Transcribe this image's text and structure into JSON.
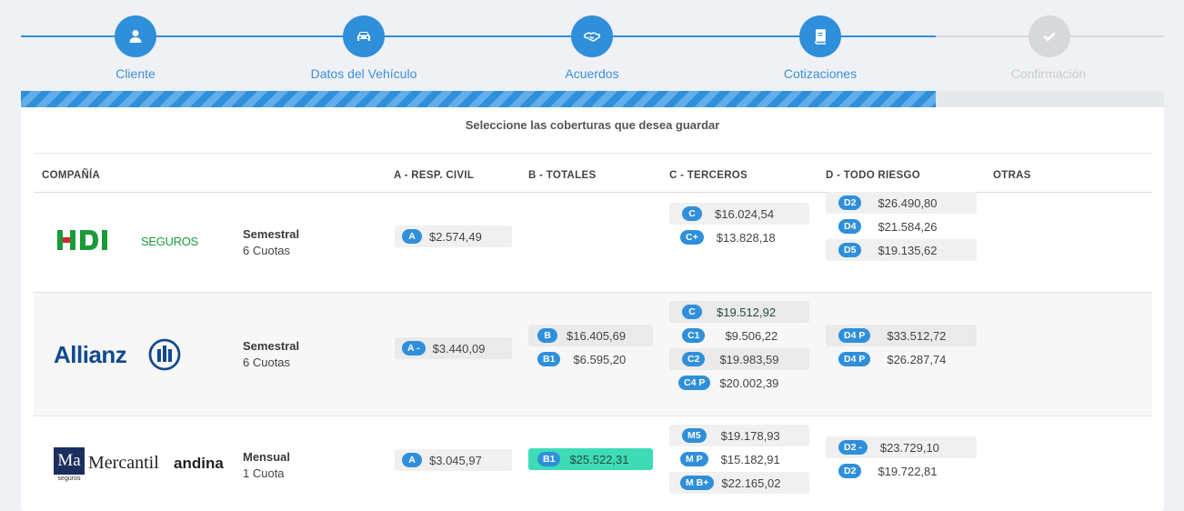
{
  "stepper": {
    "steps": [
      {
        "label": "Cliente",
        "icon": "user-icon",
        "state": "done"
      },
      {
        "label": "Datos del Vehículo",
        "icon": "car-icon",
        "state": "done"
      },
      {
        "label": "Acuerdos",
        "icon": "handshake-icon",
        "state": "done"
      },
      {
        "label": "Cotizaciones",
        "icon": "book-icon",
        "state": "current"
      },
      {
        "label": "Confirmación",
        "icon": "check-icon",
        "state": "pending"
      }
    ],
    "progress_fraction": 0.8,
    "accent": "#2f8fdb"
  },
  "card": {
    "title": "Seleccione las coberturas que desea guardar",
    "headers": {
      "company": "COMPAÑÍA",
      "a": "A - RESP. CIVIL",
      "b": "B - TOTALES",
      "c": "C - TERCEROS",
      "d": "D - TODO RIESGO",
      "other": "OTRAS"
    },
    "rows": [
      {
        "company": "HDI SEGUROS",
        "logo_main": "HDI",
        "logo_sub": "SEGUROS",
        "plan": "Semestral",
        "cuotas": "6 Cuotas",
        "a": [
          {
            "tag": "A",
            "amount": "$2.574,49"
          }
        ],
        "b": [],
        "c": [
          {
            "tag": "C",
            "amount": "$16.024,54"
          },
          {
            "tag": "C+",
            "amount": "$13.828,18"
          }
        ],
        "d": [
          {
            "tag": "D2",
            "amount": "$26.490,80"
          },
          {
            "tag": "D4",
            "amount": "$21.584,26"
          },
          {
            "tag": "D5",
            "amount": "$19.135,62"
          }
        ]
      },
      {
        "company": "Allianz",
        "logo_main": "Allianz",
        "plan": "Semestral",
        "cuotas": "6 Cuotas",
        "a": [
          {
            "tag": "A -",
            "amount": "$3.440,09"
          }
        ],
        "b": [
          {
            "tag": "B",
            "amount": "$16.405,69"
          },
          {
            "tag": "B1",
            "amount": "$6.595,20"
          }
        ],
        "c": [
          {
            "tag": "C",
            "amount": "$19.512,92",
            "selected": true
          },
          {
            "tag": "C1",
            "amount": "$9.506,22"
          },
          {
            "tag": "C2",
            "amount": "$19.983,59"
          },
          {
            "tag": "C4 P",
            "amount": "$20.002,39"
          }
        ],
        "d": [
          {
            "tag": "D4 P",
            "amount": "$33.512,72"
          },
          {
            "tag": "D4 P",
            "amount": "$26.287,74"
          }
        ]
      },
      {
        "company": "Mercantil andina",
        "logo_mark": "Ma",
        "logo_main": "Mercantil",
        "logo_bold": "andina",
        "logo_sub": "seguros",
        "plan": "Mensual",
        "cuotas": "1 Cuota",
        "a": [
          {
            "tag": "A",
            "amount": "$3.045,97"
          }
        ],
        "b": [
          {
            "tag": "B1",
            "amount": "$25.522,31",
            "selected": true
          }
        ],
        "c": [
          {
            "tag": "M5",
            "amount": "$19.178,93"
          },
          {
            "tag": "M P",
            "amount": "$15.182,91"
          },
          {
            "tag": "M B+",
            "amount": "$22.165,02"
          }
        ],
        "d": [
          {
            "tag": "D2 -",
            "amount": "$23.729,10"
          },
          {
            "tag": "D2",
            "amount": "$19.722,81"
          }
        ]
      }
    ]
  }
}
